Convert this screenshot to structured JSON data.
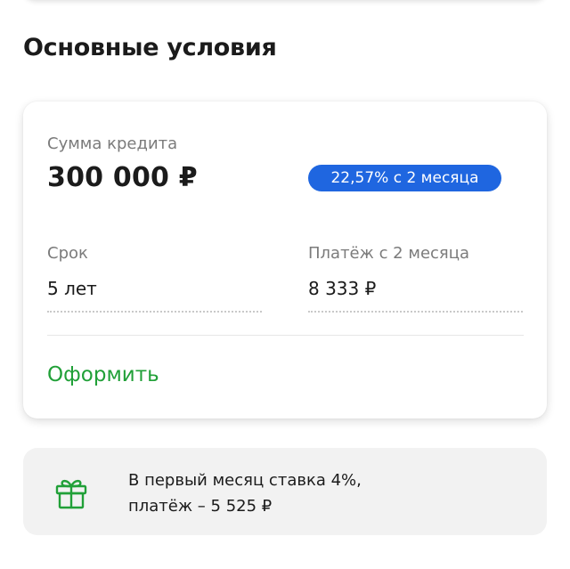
{
  "section": {
    "title": "Основные условия"
  },
  "loan": {
    "amount_label": "Сумма кредита",
    "amount_value": "300 000 ₽",
    "rate_badge": "22,57% с 2 месяца",
    "term_label": "Срок",
    "term_value": "5 лет",
    "payment_label": "Платёж с 2 месяца",
    "payment_value": "8 333 ₽",
    "apply_label": "Оформить"
  },
  "promo": {
    "icon": "gift-icon",
    "line1": "В первый месяц ставка 4%,",
    "line2": "платёж – 5 525 ₽"
  },
  "colors": {
    "accent_green": "#21a038",
    "badge_blue": "#1f66e0",
    "promo_bg": "#f2f2f2"
  }
}
